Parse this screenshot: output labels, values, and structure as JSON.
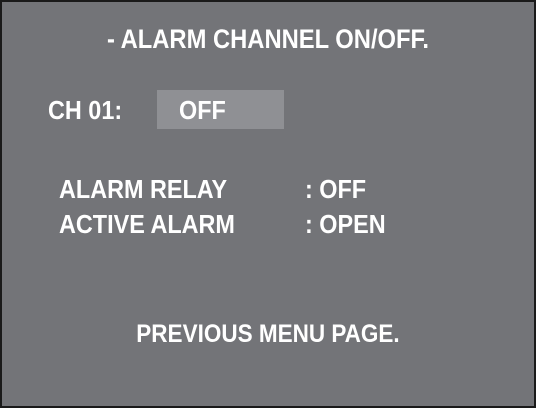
{
  "title": "- ALARM CHANNEL ON/OFF.",
  "channel": {
    "label": "CH 01:",
    "value": "OFF"
  },
  "settings": [
    {
      "label": "ALARM RELAY",
      "value": ": OFF"
    },
    {
      "label": "ACTIVE ALARM",
      "value": ": OPEN"
    }
  ],
  "footer": "PREVIOUS MENU PAGE.",
  "colors": {
    "background": "#737478",
    "highlight": "#8f9094",
    "text": "#ffffff",
    "border": "#1a1a1a"
  }
}
